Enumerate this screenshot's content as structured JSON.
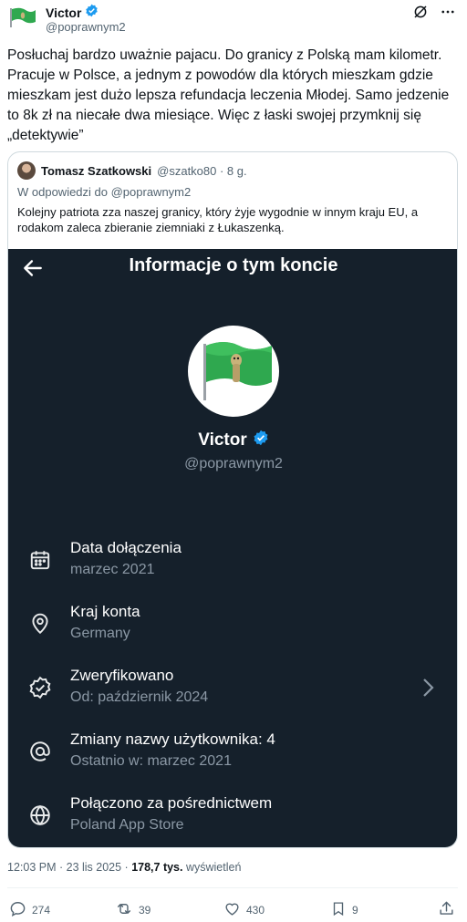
{
  "author": {
    "name": "Victor",
    "handle": "@poprawnym2"
  },
  "tweet": {
    "text": "Posłuchaj bardzo uważnie pajacu. Do granicy z Polską mam kilometr. Pracuje w Polsce, a jednym z powodów dla których mieszkam gdzie mieszkam jest dużo lepsza refundacja leczenia Młodej. Samo jedzenie to 8k zł na niecałe dwa miesiące. Więc z łaski swojej przymknij się „detektywie”"
  },
  "quote": {
    "author_name": "Tomasz Szatkowski",
    "author_meta": "@szatko80 · 8 g.",
    "reply_to": "W odpowiedzi do @poprawnym2",
    "text": "Kolejny patriota zza naszej granicy, który żyje wygodnie w innym kraju EU, a rodakom zaleca zbieranie ziemniaki z Łukaszenką."
  },
  "account_info": {
    "title": "Informacje o tym koncie",
    "name": "Victor",
    "handle": "@poprawnym2",
    "rows": [
      {
        "title": "Data dołączenia",
        "sub": "marzec 2021",
        "icon": "calendar-icon"
      },
      {
        "title": "Kraj konta",
        "sub": "Germany",
        "icon": "location-pin-icon"
      },
      {
        "title": "Zweryfikowano",
        "sub": "Od: październik 2024",
        "icon": "verified-badge-icon"
      },
      {
        "title": "Zmiany nazwy użytkownika: 4",
        "sub": "Ostatnio w: marzec 2021",
        "icon": "at-sign-icon"
      },
      {
        "title": "Połączono za pośrednictwem",
        "sub": "Poland App Store",
        "icon": "globe-icon"
      }
    ]
  },
  "meta": {
    "time_date": "12:03 PM · 23 lis 2025 · ",
    "views_count": "178,7 tys.",
    "views_label": " wyświetleń"
  },
  "actions": {
    "replies": "274",
    "reposts": "39",
    "likes": "430",
    "bookmarks": "9"
  },
  "colors": {
    "accent": "#1d9bf0",
    "dark_bg": "#15202b",
    "muted": "#536471"
  }
}
